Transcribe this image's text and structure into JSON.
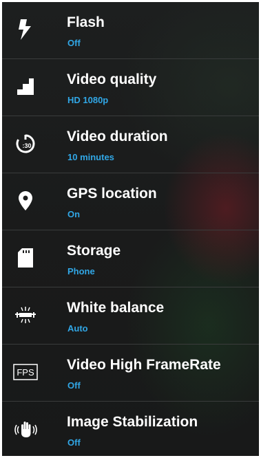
{
  "settings": {
    "items": [
      {
        "title": "Flash",
        "value": "Off",
        "icon": "flash-icon"
      },
      {
        "title": "Video quality",
        "value": "HD 1080p",
        "icon": "signal-steps-icon"
      },
      {
        "title": "Video duration",
        "value": "10 minutes",
        "icon": "timer-icon"
      },
      {
        "title": "GPS location",
        "value": "On",
        "icon": "location-pin-icon"
      },
      {
        "title": "Storage",
        "value": "Phone",
        "icon": "sd-card-icon"
      },
      {
        "title": "White balance",
        "value": "Auto",
        "icon": "fluorescent-light-icon"
      },
      {
        "title": "Video High FrameRate",
        "value": "Off",
        "icon": "fps-icon",
        "icon_text": "FPS"
      },
      {
        "title": "Image Stabilization",
        "value": "Off",
        "icon": "stabilization-hand-icon"
      }
    ]
  },
  "colors": {
    "background": "#1b1c1c",
    "title_text": "#ffffff",
    "value_text": "#31a7e6",
    "divider": "#3a3c3c",
    "frame": "#ffffff"
  }
}
